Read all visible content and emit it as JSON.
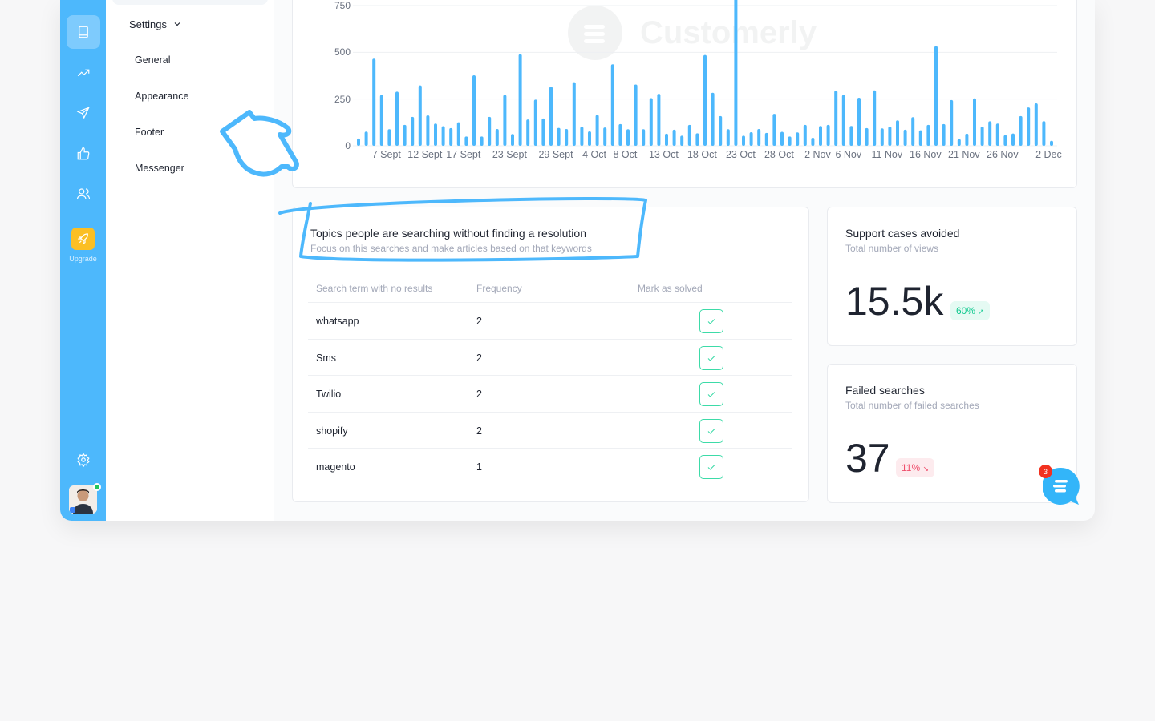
{
  "rail": {
    "items": [
      {
        "icon": "book-icon",
        "active": true
      },
      {
        "icon": "trending-up-icon"
      },
      {
        "icon": "send-icon"
      },
      {
        "icon": "thumbs-up-icon"
      },
      {
        "icon": "users-icon"
      }
    ],
    "upgrade_label": "Upgrade",
    "settings_icon": "gear-icon"
  },
  "nav": {
    "header": "Settings",
    "items": [
      "General",
      "Appearance",
      "Footer",
      "Messenger"
    ]
  },
  "watermark": "Customerly",
  "chart_data": {
    "type": "bar",
    "y_ticks": [
      0,
      250,
      500,
      750
    ],
    "ylim": [
      0,
      750
    ],
    "grid": true,
    "color": "#4db8fc",
    "x_ticks": [
      {
        "label": "7 Sept",
        "index": 3
      },
      {
        "label": "12 Sept",
        "index": 8
      },
      {
        "label": "17 Sept",
        "index": 13
      },
      {
        "label": "23 Sept",
        "index": 19
      },
      {
        "label": "29 Sept",
        "index": 25
      },
      {
        "label": "4 Oct",
        "index": 30
      },
      {
        "label": "8 Oct",
        "index": 34
      },
      {
        "label": "13 Oct",
        "index": 39
      },
      {
        "label": "18 Oct",
        "index": 44
      },
      {
        "label": "23 Oct",
        "index": 49
      },
      {
        "label": "28 Oct",
        "index": 54
      },
      {
        "label": "2 Nov",
        "index": 59
      },
      {
        "label": "6 Nov",
        "index": 63
      },
      {
        "label": "11 Nov",
        "index": 68
      },
      {
        "label": "16 Nov",
        "index": 73
      },
      {
        "label": "21 Nov",
        "index": 78
      },
      {
        "label": "26 Nov",
        "index": 83
      },
      {
        "label": "2 Dec",
        "index": 89
      }
    ],
    "values": [
      39,
      76,
      466,
      272,
      89,
      290,
      112,
      155,
      323,
      163,
      119,
      105,
      95,
      126,
      50,
      377,
      50,
      155,
      90,
      272,
      63,
      490,
      141,
      247,
      146,
      316,
      96,
      90,
      340,
      102,
      77,
      165,
      98,
      436,
      116,
      89,
      328,
      89,
      255,
      278,
      65,
      86,
      54,
      112,
      67,
      486,
      284,
      159,
      89,
      820,
      54,
      73,
      90,
      69,
      171,
      75,
      50,
      72,
      112,
      43,
      106,
      112,
      295,
      272,
      106,
      257,
      95,
      297,
      93,
      103,
      136,
      86,
      153,
      83,
      112,
      533,
      116,
      245,
      36,
      65,
      254,
      103,
      131,
      119,
      57,
      66,
      159,
      205,
      227,
      132,
      27
    ]
  },
  "table_card": {
    "title": "Topics people are searching without finding a resolution",
    "subtitle": "Focus on this searches and make articles based on that keywords",
    "columns": [
      "Search term with no results",
      "Frequency",
      "Mark as solved"
    ],
    "rows": [
      {
        "term": "whatsapp",
        "frequency": "2"
      },
      {
        "term": "Sms",
        "frequency": "2"
      },
      {
        "term": "Twilio",
        "frequency": "2"
      },
      {
        "term": "shopify",
        "frequency": "2"
      },
      {
        "term": "magento",
        "frequency": "1"
      }
    ]
  },
  "stats": [
    {
      "title": "Support cases avoided",
      "subtitle": "Total number of views",
      "value": "15.5k",
      "change": "60%",
      "trend": "up",
      "color": "#10c98f"
    },
    {
      "title": "Failed searches",
      "subtitle": "Total number of failed searches",
      "value": "37",
      "change": "11%",
      "trend": "down",
      "color": "#ef4d6b"
    }
  ],
  "chat_widget": {
    "badge": "3"
  }
}
